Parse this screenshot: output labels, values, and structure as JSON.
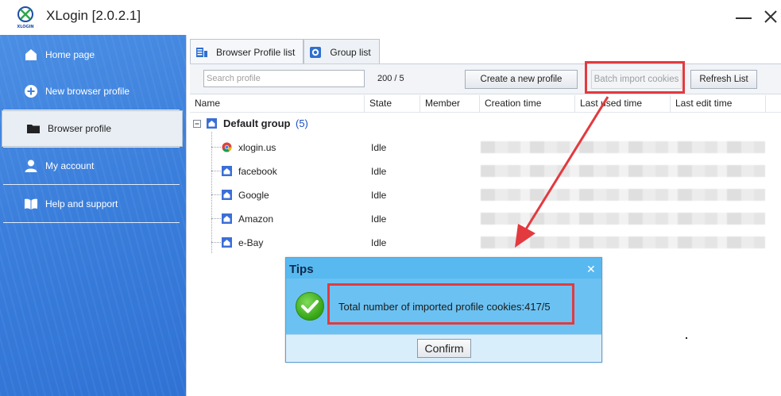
{
  "window": {
    "title": "XLogin [2.0.2.1]",
    "logo_text": "XLOGIN"
  },
  "sidebar": {
    "items": [
      {
        "label": "Home page",
        "icon": "home-icon"
      },
      {
        "label": "New browser profile",
        "icon": "plus-circle-icon"
      },
      {
        "label": "Browser profile",
        "icon": "folder-icon",
        "active": true
      },
      {
        "label": "My account",
        "icon": "user-icon"
      },
      {
        "label": "Help and support",
        "icon": "book-icon"
      }
    ]
  },
  "tabs": [
    {
      "label": "Browser Profile list",
      "icon": "list-icon",
      "active": true
    },
    {
      "label": "Group list",
      "icon": "gear-icon"
    }
  ],
  "toolbar": {
    "search_placeholder": "Search profile",
    "count": "200 / 5",
    "create_label": "Create a new profile",
    "batch_label": "Batch import cookies",
    "refresh_label": "Refresh List"
  },
  "table": {
    "columns": [
      "Name",
      "State",
      "Member",
      "Creation time",
      "Last used time",
      "Last edit time"
    ],
    "group": {
      "name": "Default group",
      "count": "(5)"
    },
    "rows": [
      {
        "name": "xlogin.us",
        "state": "Idle",
        "icon": "chrome-icon"
      },
      {
        "name": "facebook",
        "state": "Idle",
        "icon": "home-icon"
      },
      {
        "name": "Google",
        "state": "Idle",
        "icon": "home-icon"
      },
      {
        "name": "Amazon",
        "state": "Idle",
        "icon": "home-icon"
      },
      {
        "name": "e-Bay",
        "state": "Idle",
        "icon": "home-icon"
      }
    ]
  },
  "dialog": {
    "title": "Tips",
    "message": "Total number of imported profile cookies:417/5",
    "confirm_label": "Confirm"
  },
  "colors": {
    "sidebar_blue": "#3b7fdc",
    "highlight_red": "#e23a3f",
    "dialog_blue": "#58b8f0",
    "group_count_blue": "#1a4fc4"
  }
}
